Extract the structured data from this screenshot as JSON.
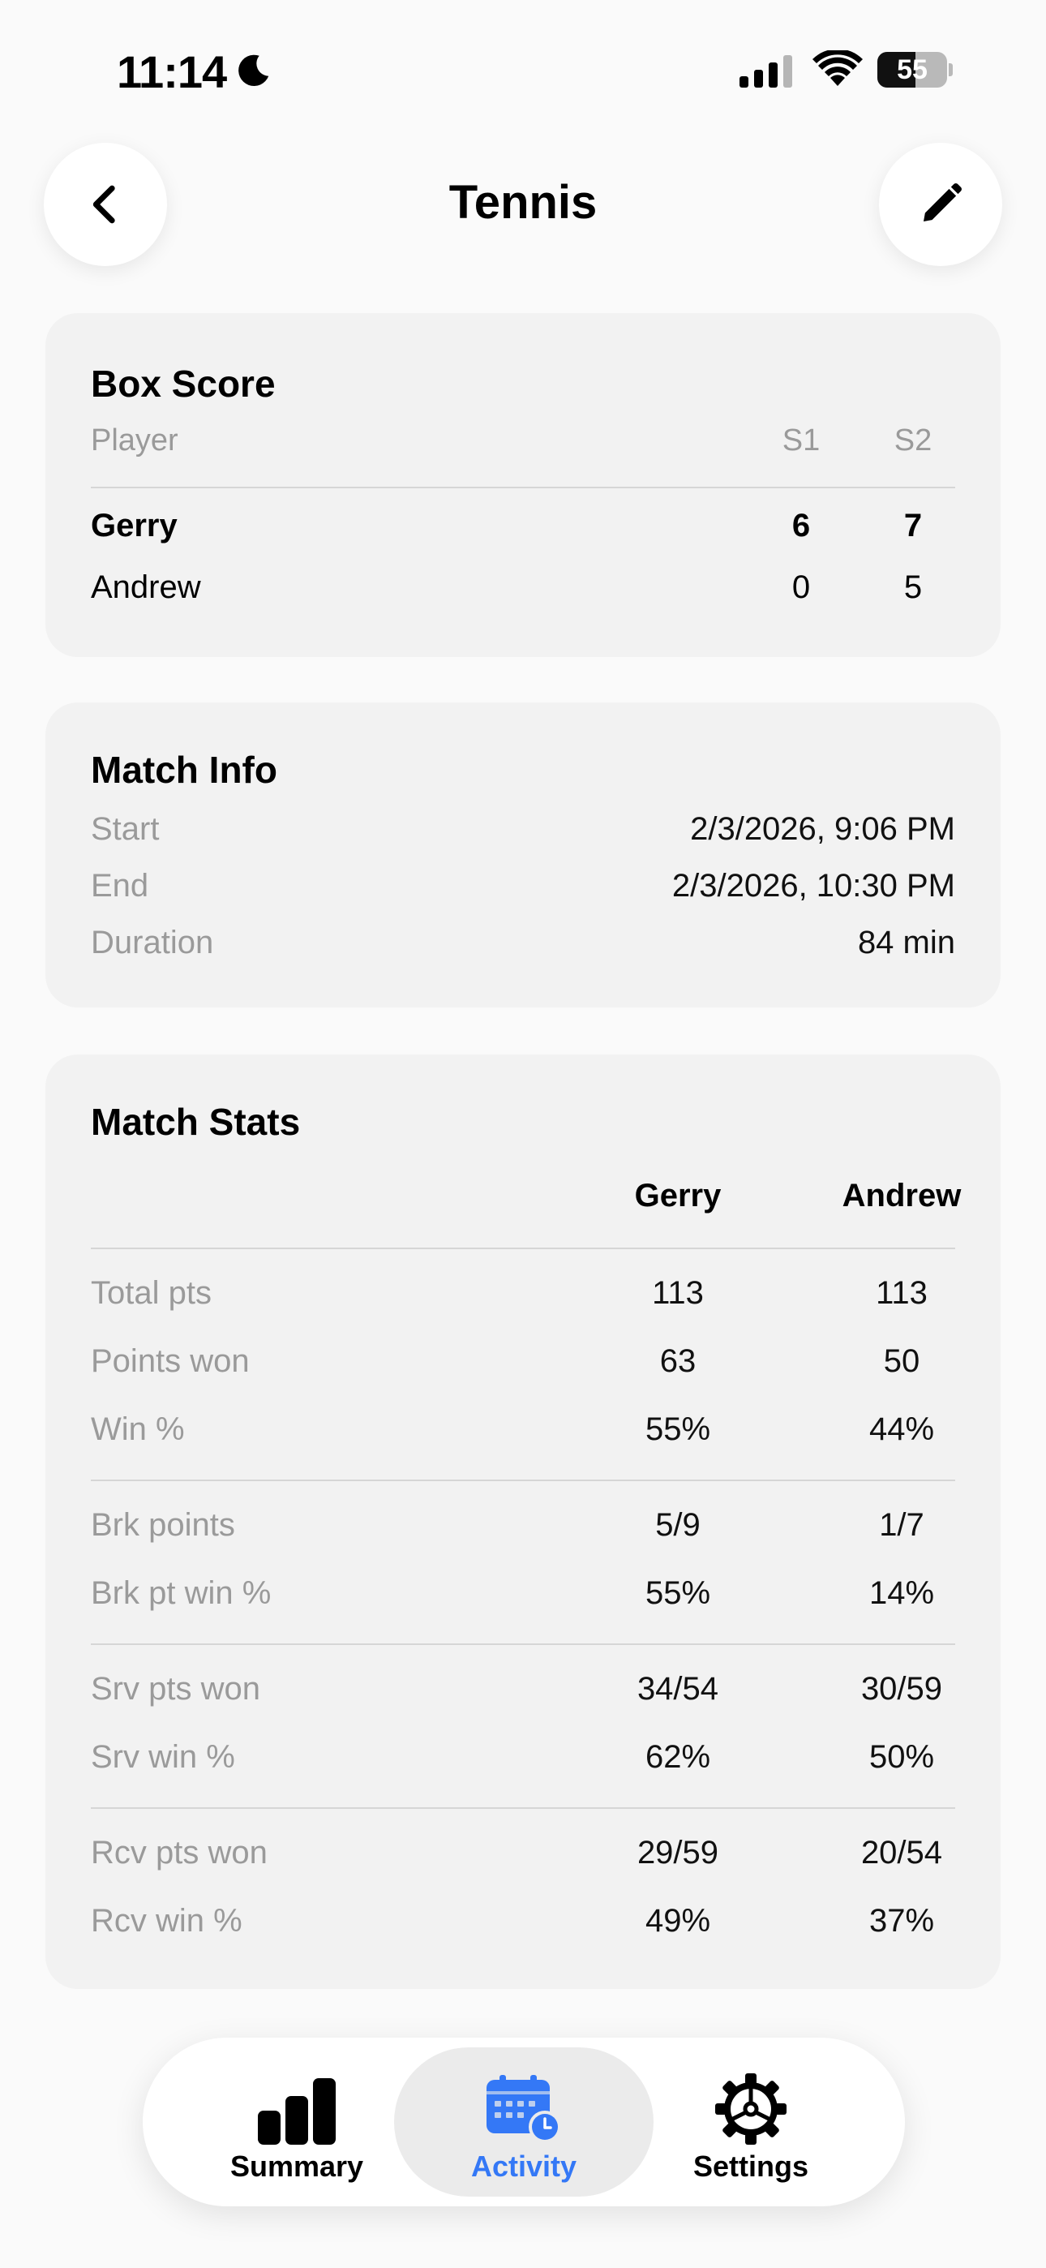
{
  "status_bar": {
    "time": "11:14",
    "battery": "55",
    "battery_fraction": 0.55,
    "icons": [
      "moon-icon",
      "signal-icon",
      "wifi-icon",
      "battery-icon"
    ]
  },
  "header": {
    "title": "Tennis",
    "back_icon": "chevron-left-icon",
    "edit_icon": "pencil-icon"
  },
  "box_score": {
    "title": "Box Score",
    "columns": {
      "player": "Player",
      "s1": "S1",
      "s2": "S2"
    },
    "rows": [
      {
        "name": "Gerry",
        "s1": "6",
        "s2": "7",
        "winner": true
      },
      {
        "name": "Andrew",
        "s1": "0",
        "s2": "5",
        "winner": false
      }
    ]
  },
  "match_info": {
    "title": "Match Info",
    "rows": [
      {
        "label": "Start",
        "value": "2/3/2026, 9:06 PM"
      },
      {
        "label": "End",
        "value": "2/3/2026, 10:30 PM"
      },
      {
        "label": "Duration",
        "value": "84 min"
      }
    ]
  },
  "match_stats": {
    "title": "Match Stats",
    "players": [
      "Gerry",
      "Andrew"
    ],
    "rows": [
      {
        "label": "Total pts",
        "p1": "113",
        "p2": "113"
      },
      {
        "label": "Points won",
        "p1": "63",
        "p2": "50"
      },
      {
        "label": "Win %",
        "p1": "55%",
        "p2": "44%"
      },
      {
        "label": "Brk points",
        "p1": "5/9",
        "p2": "1/7"
      },
      {
        "label": "Brk pt win %",
        "p1": "55%",
        "p2": "14%"
      },
      {
        "label": "Srv pts won",
        "p1": "34/54",
        "p2": "30/59"
      },
      {
        "label": "Srv win %",
        "p1": "62%",
        "p2": "50%"
      },
      {
        "label": "Rcv pts won",
        "p1": "29/59",
        "p2": "20/54"
      },
      {
        "label": "Rcv win %",
        "p1": "49%",
        "p2": "37%"
      }
    ]
  },
  "tab_bar": {
    "active": "Activity",
    "accent_color": "#3478f6",
    "tabs": [
      {
        "label": "Summary",
        "icon": "bar-chart-icon"
      },
      {
        "label": "Activity",
        "icon": "calendar-clock-icon"
      },
      {
        "label": "Settings",
        "icon": "gear-icon"
      }
    ]
  }
}
